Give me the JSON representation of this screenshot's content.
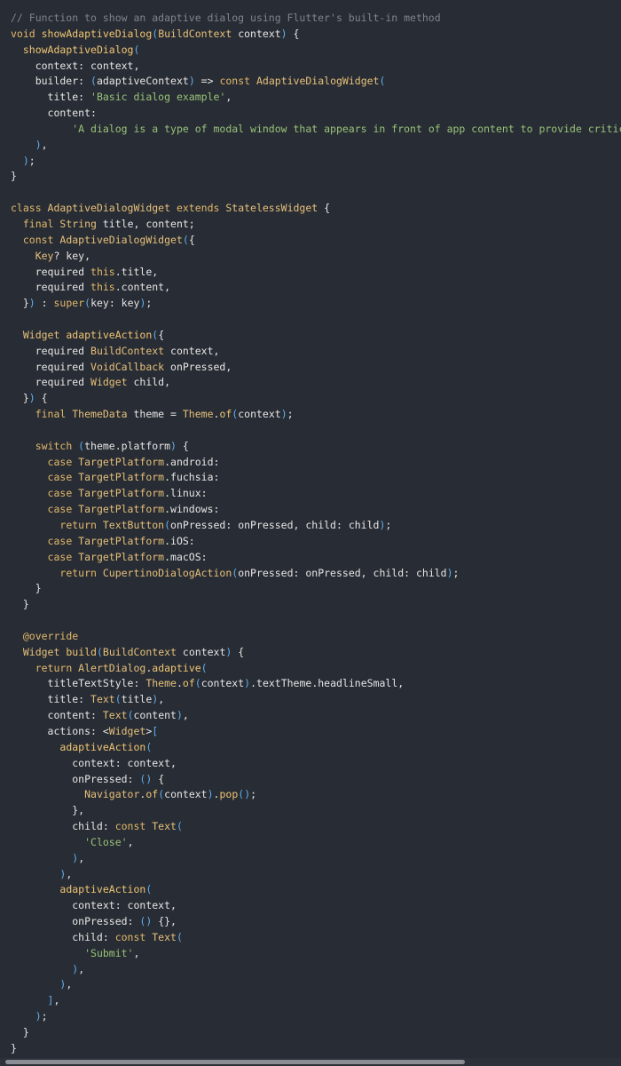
{
  "code_block": {
    "language": "dart",
    "lines": [
      [
        [
          "comment",
          "// Function to show an adaptive dialog using Flutter's built-in method"
        ]
      ],
      [
        [
          "keyword",
          "void "
        ],
        [
          "function",
          "showAdaptiveDialog"
        ],
        [
          "punct",
          "("
        ],
        [
          "type",
          "BuildContext"
        ],
        [
          "plain",
          " context"
        ],
        [
          "punct",
          ")"
        ],
        [
          "plain",
          " {"
        ]
      ],
      [
        [
          "plain",
          "  "
        ],
        [
          "function",
          "showAdaptiveDialog"
        ],
        [
          "punct",
          "("
        ]
      ],
      [
        [
          "plain",
          "    context: context,"
        ]
      ],
      [
        [
          "plain",
          "    builder: "
        ],
        [
          "punct",
          "("
        ],
        [
          "plain",
          "adaptiveContext"
        ],
        [
          "punct",
          ")"
        ],
        [
          "plain",
          " => "
        ],
        [
          "keyword",
          "const "
        ],
        [
          "type",
          "AdaptiveDialogWidget"
        ],
        [
          "punct",
          "("
        ]
      ],
      [
        [
          "plain",
          "      title: "
        ],
        [
          "string",
          "'Basic dialog example'"
        ],
        [
          "plain",
          ","
        ]
      ],
      [
        [
          "plain",
          "      content:"
        ]
      ],
      [
        [
          "plain",
          "          "
        ],
        [
          "string",
          "'A dialog is a type of modal window that appears in front of app content to provide critical information, or prompt for a decision to be made.'"
        ],
        [
          "plain",
          ","
        ]
      ],
      [
        [
          "plain",
          "    "
        ],
        [
          "punct",
          ")"
        ],
        [
          "plain",
          ","
        ]
      ],
      [
        [
          "plain",
          "  "
        ],
        [
          "punct",
          ")"
        ],
        [
          "plain",
          ";"
        ]
      ],
      [
        [
          "plain",
          "}"
        ]
      ],
      [
        [
          "plain",
          ""
        ]
      ],
      [
        [
          "keyword",
          "class "
        ],
        [
          "type",
          "AdaptiveDialogWidget"
        ],
        [
          "keyword",
          " extends "
        ],
        [
          "type",
          "StatelessWidget"
        ],
        [
          "plain",
          " {"
        ]
      ],
      [
        [
          "plain",
          "  "
        ],
        [
          "keyword",
          "final "
        ],
        [
          "type",
          "String"
        ],
        [
          "plain",
          " title, content;"
        ]
      ],
      [
        [
          "plain",
          "  "
        ],
        [
          "keyword",
          "const "
        ],
        [
          "type",
          "AdaptiveDialogWidget"
        ],
        [
          "punct",
          "("
        ],
        [
          "plain",
          "{"
        ]
      ],
      [
        [
          "plain",
          "    "
        ],
        [
          "type",
          "Key"
        ],
        [
          "plain",
          "? key,"
        ]
      ],
      [
        [
          "plain",
          "    required "
        ],
        [
          "keyword",
          "this"
        ],
        [
          "plain",
          ".title,"
        ]
      ],
      [
        [
          "plain",
          "    required "
        ],
        [
          "keyword",
          "this"
        ],
        [
          "plain",
          ".content,"
        ]
      ],
      [
        [
          "plain",
          "  }"
        ],
        [
          "punct",
          ")"
        ],
        [
          "plain",
          " : "
        ],
        [
          "keyword",
          "super"
        ],
        [
          "punct",
          "("
        ],
        [
          "plain",
          "key: key"
        ],
        [
          "punct",
          ")"
        ],
        [
          "plain",
          ";"
        ]
      ],
      [
        [
          "plain",
          ""
        ]
      ],
      [
        [
          "plain",
          "  "
        ],
        [
          "type",
          "Widget"
        ],
        [
          "plain",
          " "
        ],
        [
          "function",
          "adaptiveAction"
        ],
        [
          "punct",
          "("
        ],
        [
          "plain",
          "{"
        ]
      ],
      [
        [
          "plain",
          "    required "
        ],
        [
          "type",
          "BuildContext"
        ],
        [
          "plain",
          " context,"
        ]
      ],
      [
        [
          "plain",
          "    required "
        ],
        [
          "type",
          "VoidCallback"
        ],
        [
          "plain",
          " onPressed,"
        ]
      ],
      [
        [
          "plain",
          "    required "
        ],
        [
          "type",
          "Widget"
        ],
        [
          "plain",
          " child,"
        ]
      ],
      [
        [
          "plain",
          "  }"
        ],
        [
          "punct",
          ")"
        ],
        [
          "plain",
          " {"
        ]
      ],
      [
        [
          "plain",
          "    "
        ],
        [
          "keyword",
          "final "
        ],
        [
          "type",
          "ThemeData"
        ],
        [
          "plain",
          " theme = "
        ],
        [
          "type",
          "Theme"
        ],
        [
          "plain",
          "."
        ],
        [
          "function",
          "of"
        ],
        [
          "punct",
          "("
        ],
        [
          "plain",
          "context"
        ],
        [
          "punct",
          ")"
        ],
        [
          "plain",
          ";"
        ]
      ],
      [
        [
          "plain",
          ""
        ]
      ],
      [
        [
          "plain",
          "    "
        ],
        [
          "keyword",
          "switch "
        ],
        [
          "punct",
          "("
        ],
        [
          "plain",
          "theme.platform"
        ],
        [
          "punct",
          ")"
        ],
        [
          "plain",
          " {"
        ]
      ],
      [
        [
          "plain",
          "      "
        ],
        [
          "keyword",
          "case "
        ],
        [
          "type",
          "TargetPlatform"
        ],
        [
          "plain",
          ".android:"
        ]
      ],
      [
        [
          "plain",
          "      "
        ],
        [
          "keyword",
          "case "
        ],
        [
          "type",
          "TargetPlatform"
        ],
        [
          "plain",
          ".fuchsia:"
        ]
      ],
      [
        [
          "plain",
          "      "
        ],
        [
          "keyword",
          "case "
        ],
        [
          "type",
          "TargetPlatform"
        ],
        [
          "plain",
          ".linux:"
        ]
      ],
      [
        [
          "plain",
          "      "
        ],
        [
          "keyword",
          "case "
        ],
        [
          "type",
          "TargetPlatform"
        ],
        [
          "plain",
          ".windows:"
        ]
      ],
      [
        [
          "plain",
          "        "
        ],
        [
          "keyword",
          "return "
        ],
        [
          "type",
          "TextButton"
        ],
        [
          "punct",
          "("
        ],
        [
          "plain",
          "onPressed: onPressed, child: child"
        ],
        [
          "punct",
          ")"
        ],
        [
          "plain",
          ";"
        ]
      ],
      [
        [
          "plain",
          "      "
        ],
        [
          "keyword",
          "case "
        ],
        [
          "type",
          "TargetPlatform"
        ],
        [
          "plain",
          ".iOS:"
        ]
      ],
      [
        [
          "plain",
          "      "
        ],
        [
          "keyword",
          "case "
        ],
        [
          "type",
          "TargetPlatform"
        ],
        [
          "plain",
          ".macOS:"
        ]
      ],
      [
        [
          "plain",
          "        "
        ],
        [
          "keyword",
          "return "
        ],
        [
          "type",
          "CupertinoDialogAction"
        ],
        [
          "punct",
          "("
        ],
        [
          "plain",
          "onPressed: onPressed, child: child"
        ],
        [
          "punct",
          ")"
        ],
        [
          "plain",
          ";"
        ]
      ],
      [
        [
          "plain",
          "    }"
        ]
      ],
      [
        [
          "plain",
          "  }"
        ]
      ],
      [
        [
          "plain",
          ""
        ]
      ],
      [
        [
          "plain",
          "  "
        ],
        [
          "annot",
          "@override"
        ]
      ],
      [
        [
          "plain",
          "  "
        ],
        [
          "type",
          "Widget"
        ],
        [
          "plain",
          " "
        ],
        [
          "function",
          "build"
        ],
        [
          "punct",
          "("
        ],
        [
          "type",
          "BuildContext"
        ],
        [
          "plain",
          " context"
        ],
        [
          "punct",
          ")"
        ],
        [
          "plain",
          " {"
        ]
      ],
      [
        [
          "plain",
          "    "
        ],
        [
          "keyword",
          "return "
        ],
        [
          "type",
          "AlertDialog"
        ],
        [
          "plain",
          "."
        ],
        [
          "function",
          "adaptive"
        ],
        [
          "punct",
          "("
        ]
      ],
      [
        [
          "plain",
          "      titleTextStyle: "
        ],
        [
          "type",
          "Theme"
        ],
        [
          "plain",
          "."
        ],
        [
          "function",
          "of"
        ],
        [
          "punct",
          "("
        ],
        [
          "plain",
          "context"
        ],
        [
          "punct",
          ")"
        ],
        [
          "plain",
          ".textTheme.headlineSmall,"
        ]
      ],
      [
        [
          "plain",
          "      title: "
        ],
        [
          "type",
          "Text"
        ],
        [
          "punct",
          "("
        ],
        [
          "plain",
          "title"
        ],
        [
          "punct",
          ")"
        ],
        [
          "plain",
          ","
        ]
      ],
      [
        [
          "plain",
          "      content: "
        ],
        [
          "type",
          "Text"
        ],
        [
          "punct",
          "("
        ],
        [
          "plain",
          "content"
        ],
        [
          "punct",
          ")"
        ],
        [
          "plain",
          ","
        ]
      ],
      [
        [
          "plain",
          "      actions: <"
        ],
        [
          "type",
          "Widget"
        ],
        [
          "plain",
          ">"
        ],
        [
          "punct",
          "["
        ]
      ],
      [
        [
          "plain",
          "        "
        ],
        [
          "function",
          "adaptiveAction"
        ],
        [
          "punct",
          "("
        ]
      ],
      [
        [
          "plain",
          "          context: context,"
        ]
      ],
      [
        [
          "plain",
          "          onPressed: "
        ],
        [
          "punct",
          "()"
        ],
        [
          "plain",
          " {"
        ]
      ],
      [
        [
          "plain",
          "            "
        ],
        [
          "type",
          "Navigator"
        ],
        [
          "plain",
          "."
        ],
        [
          "function",
          "of"
        ],
        [
          "punct",
          "("
        ],
        [
          "plain",
          "context"
        ],
        [
          "punct",
          ")"
        ],
        [
          "plain",
          "."
        ],
        [
          "function",
          "pop"
        ],
        [
          "punct",
          "()"
        ],
        [
          "plain",
          ";"
        ]
      ],
      [
        [
          "plain",
          "          },"
        ]
      ],
      [
        [
          "plain",
          "          child: "
        ],
        [
          "keyword",
          "const "
        ],
        [
          "type",
          "Text"
        ],
        [
          "punct",
          "("
        ]
      ],
      [
        [
          "plain",
          "            "
        ],
        [
          "string",
          "'Close'"
        ],
        [
          "plain",
          ","
        ]
      ],
      [
        [
          "plain",
          "          "
        ],
        [
          "punct",
          ")"
        ],
        [
          "plain",
          ","
        ]
      ],
      [
        [
          "plain",
          "        "
        ],
        [
          "punct",
          ")"
        ],
        [
          "plain",
          ","
        ]
      ],
      [
        [
          "plain",
          "        "
        ],
        [
          "function",
          "adaptiveAction"
        ],
        [
          "punct",
          "("
        ]
      ],
      [
        [
          "plain",
          "          context: context,"
        ]
      ],
      [
        [
          "plain",
          "          onPressed: "
        ],
        [
          "punct",
          "()"
        ],
        [
          "plain",
          " {},"
        ]
      ],
      [
        [
          "plain",
          "          child: "
        ],
        [
          "keyword",
          "const "
        ],
        [
          "type",
          "Text"
        ],
        [
          "punct",
          "("
        ]
      ],
      [
        [
          "plain",
          "            "
        ],
        [
          "string",
          "'Submit'"
        ],
        [
          "plain",
          ","
        ]
      ],
      [
        [
          "plain",
          "          "
        ],
        [
          "punct",
          ")"
        ],
        [
          "plain",
          ","
        ]
      ],
      [
        [
          "plain",
          "        "
        ],
        [
          "punct",
          ")"
        ],
        [
          "plain",
          ","
        ]
      ],
      [
        [
          "plain",
          "      "
        ],
        [
          "punct",
          "]"
        ],
        [
          "plain",
          ","
        ]
      ],
      [
        [
          "plain",
          "    "
        ],
        [
          "punct",
          ")"
        ],
        [
          "plain",
          ";"
        ]
      ],
      [
        [
          "plain",
          "  }"
        ]
      ],
      [
        [
          "plain",
          "}"
        ]
      ]
    ]
  },
  "scrollbar": {
    "orientation": "horizontal",
    "visible_fraction": 0.74
  },
  "colors": {
    "background": "#282c34",
    "comment": "#7f848e",
    "keyword": "#e2b86b",
    "type": "#e6c07b",
    "string": "#98c379",
    "punct": "#61afef",
    "plain": "#e6e6e6"
  }
}
